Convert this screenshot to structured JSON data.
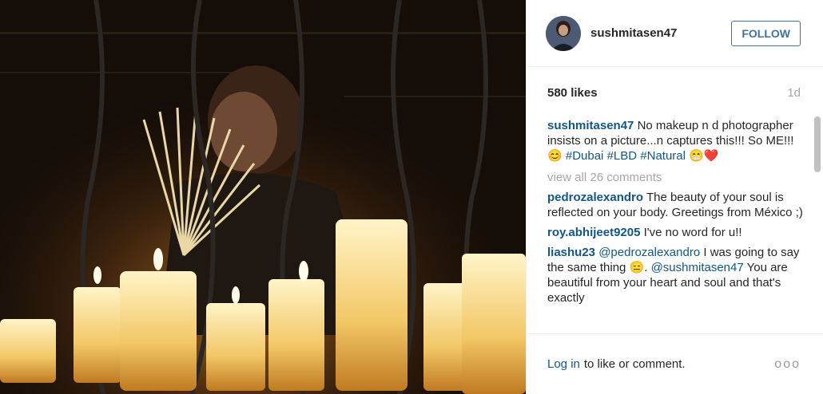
{
  "header": {
    "username": "sushmitasen47",
    "follow_label": "FOLLOW"
  },
  "stats": {
    "likes": "580 likes",
    "time": "1d"
  },
  "caption": {
    "user": "sushmitasen47",
    "text": "No makeup n d photographer insists on a picture...n captures this!!! So ME!!!😊",
    "tag1": "#Dubai",
    "tag2": "#LBD",
    "tag3": "#Natural",
    "emoji": "😁❤️"
  },
  "view_all": "view all 26 comments",
  "comments": [
    {
      "user": "pedrozalexandro",
      "text": "The beauty of your soul is reflected on your body. Greetings from México ;)"
    },
    {
      "user": "roy.abhijeet9205",
      "text": "I've no word for u!!"
    },
    {
      "user": "liashu23",
      "mention": "@pedrozalexandro",
      "text": "I was going to say the same thing 😑.",
      "mention2": "@sushmitasen47",
      "text2": "You are beautiful from your heart and soul and that's exactly"
    }
  ],
  "footer": {
    "login_label": "Log in",
    "text": "to like or comment.",
    "more_label": "ooo"
  },
  "colors": {
    "link": "#125688",
    "follow": "#3f729b",
    "muted": "#a5a7aa"
  },
  "icons": {
    "more": "more-options-icon"
  }
}
